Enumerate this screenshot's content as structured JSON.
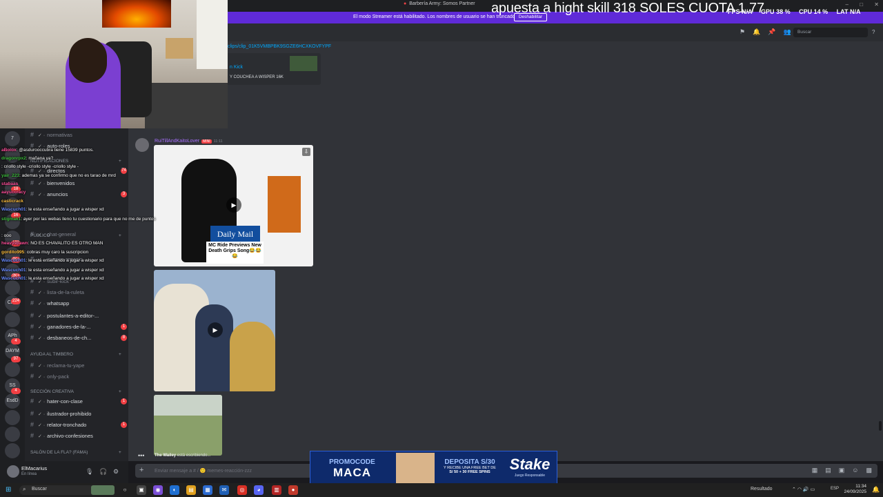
{
  "window": {
    "title": "Barbería Army: Somos Partner",
    "controls": [
      "–",
      "□",
      "✕"
    ]
  },
  "overlay_text": "apuesta a hight skill 318 SOLES CUOTA 1.77",
  "stats": {
    "fps_label": "FPS",
    "fps_value": "N/A",
    "gpu_label": "GPU",
    "gpu_value": "38 %",
    "cpu_label": "CPU",
    "cpu_value": "14 %",
    "lat_label": "LAT",
    "lat_value": "N/A"
  },
  "banner": {
    "text": "El modo Streamer está habilitado. Los nombres de usuario se han truncado.",
    "button": "Deshabilitar",
    "color": "#5f2ad8"
  },
  "guilds": {
    "items": [
      "7",
      "",
      "",
      "",
      "",
      "",
      "",
      "",
      "",
      "",
      "CnG",
      "",
      "APh",
      "DAYM",
      "",
      "SS",
      "EsdD",
      "",
      "",
      ""
    ],
    "badges": [
      "18",
      "16",
      "192",
      "4K+",
      "2K+",
      "224",
      "4",
      "97",
      "4"
    ]
  },
  "channels": {
    "items": [
      {
        "name": "normativas",
        "badge": ""
      },
      {
        "name": "auto-roles",
        "badge": ""
      },
      {
        "name": "directos",
        "badge": "74"
      },
      {
        "name": "bienvenidos",
        "badge": ""
      },
      {
        "name": "anuncios",
        "badge": "3"
      },
      {
        "name": "chat-general",
        "badge": ""
      },
      {
        "name": "memes-reaccio...",
        "badge": ""
      },
      {
        "name": "subir-kick",
        "badge": ""
      },
      {
        "name": "lista-de-la-ruleta",
        "badge": ""
      },
      {
        "name": "whatsapp",
        "badge": ""
      },
      {
        "name": "postulantes-a-editor-...",
        "badge": ""
      },
      {
        "name": "ganadores-de-la-...",
        "badge": "1"
      },
      {
        "name": "desbaneos-de-ch...",
        "badge": "8"
      },
      {
        "name": "reclama-tu-yape",
        "badge": ""
      },
      {
        "name": "only-pack",
        "badge": ""
      },
      {
        "name": "hater-con-clase",
        "badge": "1"
      },
      {
        "name": "ilustrador-prohibido",
        "badge": ""
      },
      {
        "name": "relator-tronchado",
        "badge": "1"
      },
      {
        "name": "archivo-confesiones",
        "badge": ""
      }
    ],
    "categories": {
      "notificaciones": "NOTIFICACIONES",
      "publico": "PÚBLICO",
      "ayuda": "AYUDA AL TIMBERO",
      "creativa": "SECCIÓN CREATIVA",
      "salon": "SALÓN DE LA FLA? (FAMA)"
    }
  },
  "user": {
    "name": "ElMacarius",
    "status": "En línea"
  },
  "chat_overlay": [
    {
      "user": "aBoiox",
      "text": ": @asdurooccubra tiene 15839 puntos.",
      "color": "#ff4f9a"
    },
    {
      "user": "dragonrpx2",
      "text": ": mañana ya?",
      "color": "#3fbf3f"
    },
    {
      "user": "",
      "text": ": criollo style -criollo style -criollo style -",
      "color": "#ff4f9a"
    },
    {
      "user": "yair_223",
      "text": ": ademas ya se confirmo que no es tarao de mrd",
      "color": "#3fbf3f"
    },
    {
      "user": "stabaas",
      "text": "",
      "color": "#ff4f9a"
    },
    {
      "user": "aayuccracy",
      "text": "",
      "color": "#ff4f9a"
    },
    {
      "user": "casticrack",
      "text": "",
      "color": "#ffbf3f"
    },
    {
      "user": "Wascuch01",
      "text": ": le esta enseñando a jugar a wisper xd",
      "color": "#6a8cff"
    },
    {
      "user": "stigmak1",
      "text": ": ayer por las webas lleno tu cuestionario para que no me de puntos",
      "color": "#3fbf3f"
    },
    {
      "user": "",
      "text": ": ooo",
      "color": "#fff"
    },
    {
      "user": "heavyspawn",
      "text": ": NO ES CHAVALITO ES OTRO MAN",
      "color": "#ff4f9a"
    },
    {
      "user": "gordito995",
      "text": ": cobras muy caro la suscripcion",
      "color": "#ffbf3f"
    },
    {
      "user": "Wascuch01",
      "text": ": le esta enseñando a jugar a wisper xd",
      "color": "#6a8cff"
    },
    {
      "user": "Wascuch01",
      "text": ": le esta enseñando a jugar a wisper xd",
      "color": "#6a8cff"
    },
    {
      "user": "Wascuch01",
      "text": ": le esta enseñando a jugar a wisper xd",
      "color": "#6a8cff"
    }
  ],
  "main": {
    "search_placeholder": "Buscar",
    "clip_link": "clips/clip_01K5VMBPBK9SGZE6HCXKOVFYPF",
    "embed_provider": "n Kick",
    "embed_description": "Y COUCHEA A WISPER 16K",
    "post_author": "RuiTillAndKaitoLover",
    "post_tag": "MINI",
    "post_time": "11:11",
    "media1_brand": "Daily Mail",
    "media1_caption": "MC Ride Previews New Death Grips Song😂😂😂",
    "typing_user": "The Wailey",
    "typing_text": " está escribiendo...",
    "composer_placeholder": "Enviar mensaje a #  /  🙂  memes-reacción-zzz"
  },
  "ad": {
    "promo_l1": "PROMOCODE",
    "promo_l2": "MACA",
    "dep_l1": "DEPOSITA S/30",
    "dep_l2": "Y RECIBE UNA FREE BET DE",
    "dep_l3": "S/ 50 + 30 FREE SPINS",
    "brand": "Stake",
    "brand_sub": "Juego Responsable"
  },
  "taskbar": {
    "search": "Buscar",
    "result": "Resultado",
    "lang": "ESP",
    "time": "11:34",
    "date": "24/09/2025"
  }
}
